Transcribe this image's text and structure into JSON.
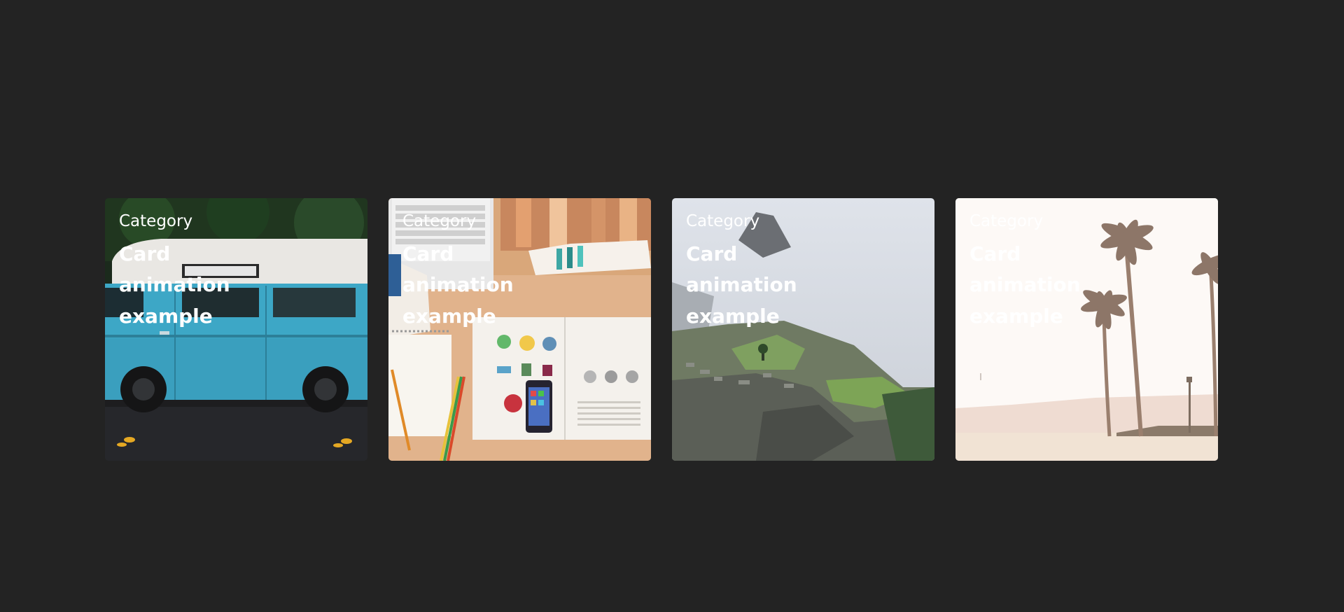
{
  "cards": [
    {
      "category": "Category",
      "title": "Card animation example",
      "image": "van-photo"
    },
    {
      "category": "Category",
      "title": "Card animation example",
      "image": "desk-photo"
    },
    {
      "category": "Category",
      "title": "Card animation example",
      "image": "mountain-photo"
    },
    {
      "category": "Category",
      "title": "Card animation example",
      "image": "beach-photo"
    }
  ]
}
